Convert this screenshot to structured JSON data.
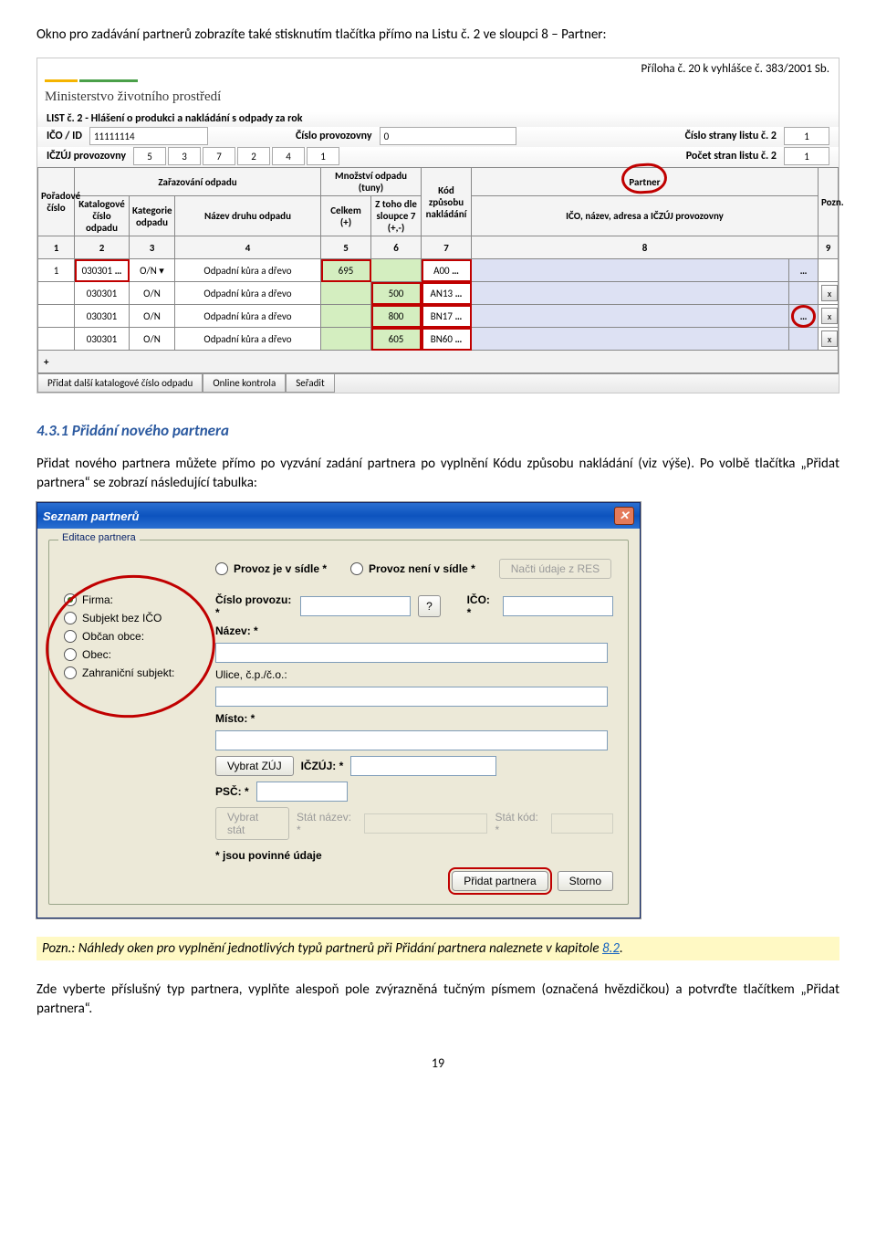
{
  "para_intro": "Okno pro zadávání partnerů zobrazíte také stisknutím tlačítka přímo na Listu č. 2 ve sloupci 8 – Partner:",
  "shot1": {
    "priloha": "Příloha č. 20 k vyhlášce č. 383/2001 Sb.",
    "ministry": "Ministerstvo životního prostředí",
    "list_title": "LIST č. 2 - Hlášení o produkci a nakládání s odpady za rok",
    "ico_label": "IČO / ID",
    "ico_value": "11111114",
    "cislo_prov_label": "Číslo provozovny",
    "cislo_prov_value": "0",
    "cislo_strany_label": "Číslo strany listu č. 2",
    "cislo_strany_value": "1",
    "iczuj_label": "IČZÚJ provozovny",
    "iczuj_values": [
      "5",
      "3",
      "7",
      "2",
      "4",
      "1"
    ],
    "pocet_stran_label": "Počet stran listu č. 2",
    "pocet_stran_value": "1",
    "colgroups": {
      "porad": "Pořadové číslo",
      "zar": "Zařazování odpadu",
      "kat": "Katalogové číslo odpadu",
      "katg": "Kategorie odpadu",
      "nazev": "Název druhu odpadu",
      "mnoz": "Množství odpadu (tuny)",
      "celkem": "Celkem (+)",
      "ztoho": "Z toho dle sloupce 7 (+,-)",
      "kod": "Kód způsobu nakládání",
      "partner": "Partner",
      "partner_sub": "IČO, název, adresa a IČZÚJ provozovny",
      "pozn": "Pozn."
    },
    "nums": [
      "1",
      "2",
      "3",
      "4",
      "5",
      "6",
      "7",
      "8",
      "9"
    ],
    "rows": [
      {
        "n": "1",
        "kat": "030301",
        "on": "O/N",
        "nazev": "Odpadní kůra a dřevo",
        "celkem": "695",
        "ztoho": "",
        "kod": "A00",
        "x": false,
        "dots": true
      },
      {
        "n": "",
        "kat": "030301",
        "on": "O/N",
        "nazev": "Odpadní kůra a dřevo",
        "celkem": "",
        "ztoho": "500",
        "kod": "AN13",
        "x": true,
        "dots": false
      },
      {
        "n": "",
        "kat": "030301",
        "on": "O/N",
        "nazev": "Odpadní kůra a dřevo",
        "celkem": "",
        "ztoho": "800",
        "kod": "BN17",
        "x": true,
        "dots": true,
        "oval": true
      },
      {
        "n": "",
        "kat": "030301",
        "on": "O/N",
        "nazev": "Odpadní kůra a dřevo",
        "celkem": "",
        "ztoho": "605",
        "kod": "BN60",
        "x": true,
        "dots": false
      }
    ],
    "plus": "+",
    "bottom_btns": [
      "Přidat další katalogové číslo odpadu",
      "Online kontrola",
      "Seřadit"
    ]
  },
  "heading": "4.3.1   Přidání nového partnera",
  "para_body1": "Přidat nového partnera můžete přímo po vyzvání zadání partnera po vyplnění Kódu způsobu nakládání (viz výše). Po volbě tlačítka „Přidat partnera“ se zobrazí následující tabulka:",
  "shot2": {
    "title": "Seznam partnerů",
    "legend": "Editace partnera",
    "types": [
      "Firma:",
      "Subjekt bez IČO",
      "Občan obce:",
      "Obec:",
      "Zahraniční subjekt:"
    ],
    "provoz1": "Provoz je v sídle *",
    "provoz2": "Provoz není v sídle *",
    "nacti": "Načti údaje z RES",
    "cislo_prov": "Číslo provozu: *",
    "q": "?",
    "ico": "IČO: *",
    "nazev": "Název: *",
    "ulice": "Ulice, č.p./č.o.:",
    "misto": "Místo: *",
    "vybrat_zuj": "Vybrat ZÚJ",
    "iczuj": "IČZÚJ: *",
    "psc": "PSČ: *",
    "vybrat_stat": "Vybrat stát",
    "stat_nazev": "Stát název: *",
    "stat_kod": "Stát kód: *",
    "povinne": "* jsou povinné údaje",
    "pridat": "Přidat partnera",
    "storno": "Storno"
  },
  "pozn": {
    "text": "Pozn.: Náhledy oken pro vyplnění jednotlivých typů partnerů při Přidání partnera naleznete v kapitole ",
    "link": "8.2",
    "dot": "."
  },
  "para_after": "Zde vyberte příslušný typ partnera, vyplňte alespoň pole zvýrazněná tučným písmem (označená hvězdičkou) a potvrďte tlačítkem „Přidat partnera“.",
  "page_num": "19"
}
